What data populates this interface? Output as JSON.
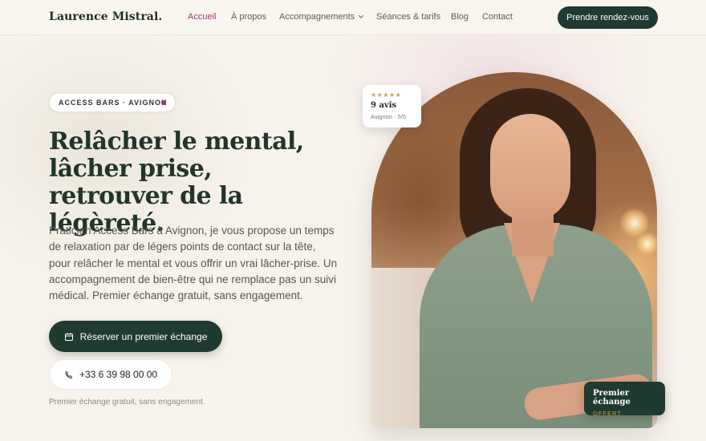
{
  "header": {
    "logo": "Laurence Mistral",
    "logo_dot": ".",
    "nav": [
      {
        "label": "Accueil",
        "active": true
      },
      {
        "label": "À propos",
        "active": false
      },
      {
        "label": "Accompagnements",
        "active": false,
        "has_dropdown": true
      },
      {
        "label": "Séances & tarifs",
        "active": false
      },
      {
        "label": "Blog",
        "active": false
      },
      {
        "label": "Contact",
        "active": false
      }
    ],
    "cta_label": "Prendre rendez-vous"
  },
  "hero": {
    "badge": "ACCESS BARS · AVIGNON",
    "headline": "Relâcher le mental, lâcher prise, retrouver de la légèreté.",
    "intro": "Praticien Access Bars à Avignon, je vous propose un temps de relaxation par de légers points de contact sur la tête, pour relâcher le mental et vous offrir un vrai lâcher-prise. Un accompagnement de bien-être qui ne remplace pas un suivi médical. Premier échange gratuit, sans engagement.",
    "primary_button": "Réserver un premier échange",
    "phone_button": "+33 6 39 98 00 00",
    "note": "Premier échange gratuit, sans engagement."
  },
  "rating_card": {
    "stars": "★★★★★",
    "title": "9 avis",
    "subtitle": "Avignon · 5/5"
  },
  "offer_card": {
    "title": "Premier échange",
    "subtitle": "OFFERT"
  },
  "colors": {
    "brand_dark": "#1f3a30",
    "accent": "#a3357f",
    "gold": "#c9a24a",
    "background": "#f7f3ec"
  },
  "icons": {
    "calendar": "calendar-icon",
    "phone": "phone-icon",
    "dropdown": "chevron-down-icon",
    "badge_dot": "status-dot-icon"
  }
}
